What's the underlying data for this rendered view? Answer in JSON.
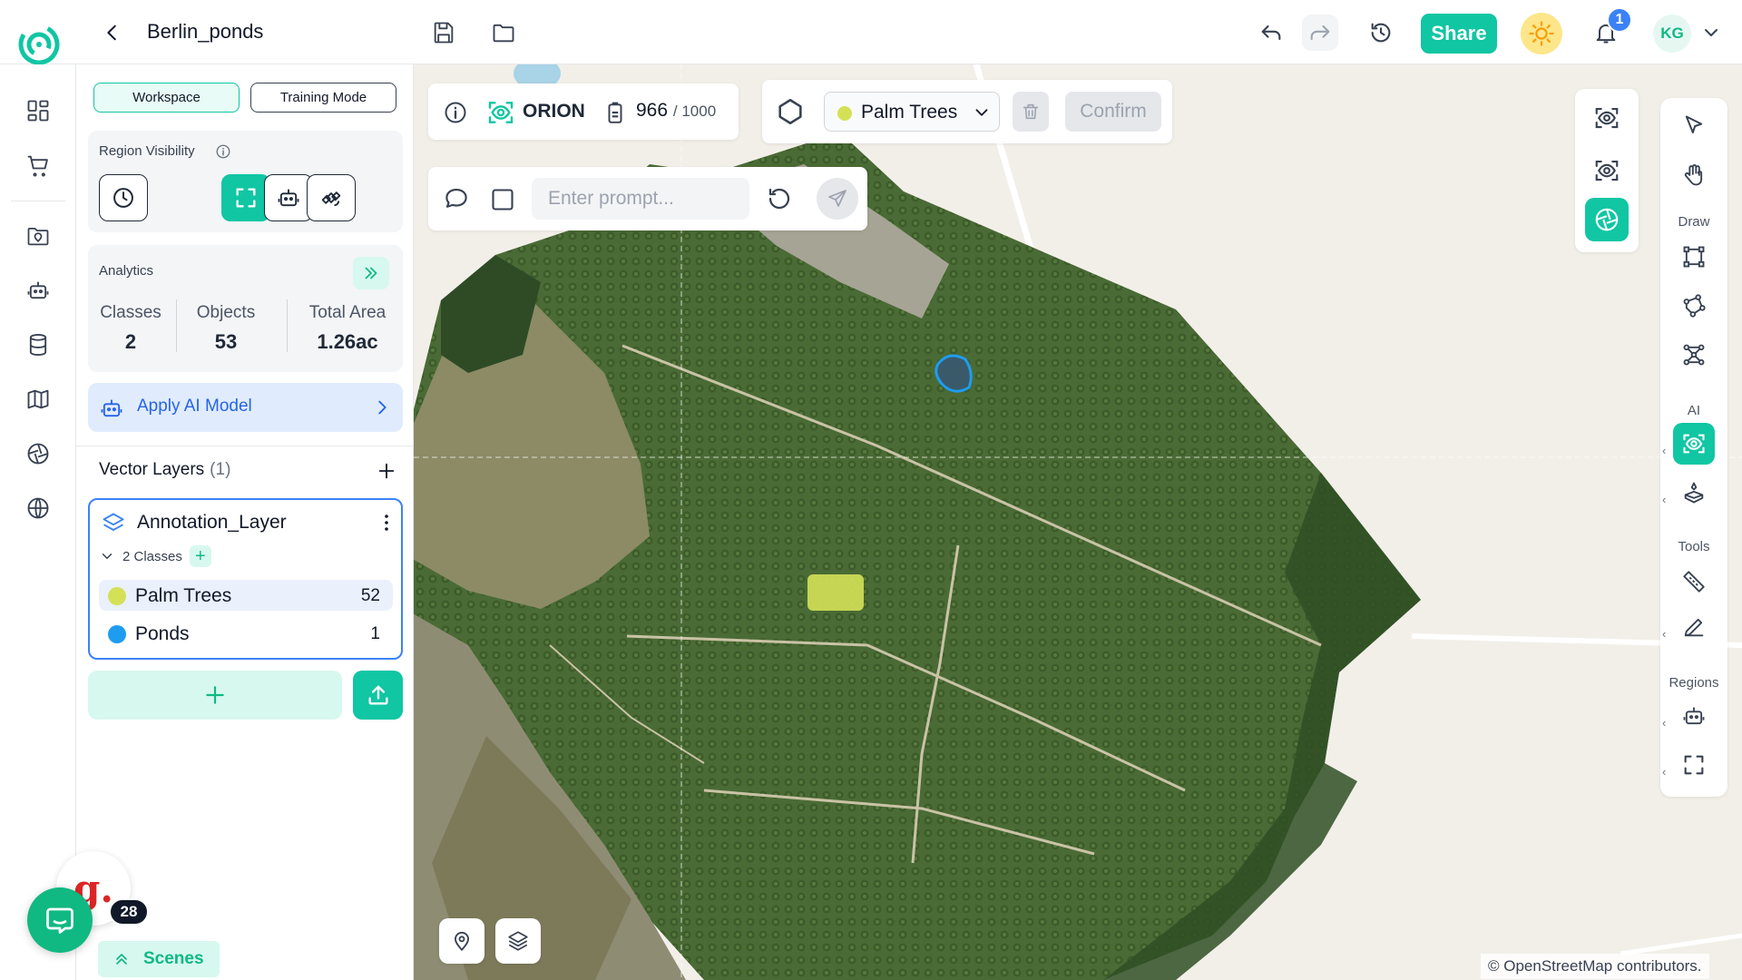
{
  "header": {
    "project_title": "Berlin_ponds",
    "share_label": "Share",
    "notification_count": "1",
    "avatar_initials": "KG"
  },
  "panel": {
    "modes": {
      "workspace": "Workspace",
      "training": "Training Mode"
    },
    "region_visibility_title": "Region Visibility",
    "analytics": {
      "title": "Analytics",
      "classes_label": "Classes",
      "classes_value": "2",
      "objects_label": "Objects",
      "objects_value": "53",
      "area_label": "Total Area",
      "area_value": "1.26ac"
    },
    "apply_ai_label": "Apply AI Model",
    "vector_layers": {
      "title": "Vector Layers",
      "count": "(1)"
    },
    "layer": {
      "name": "Annotation_Layer",
      "classes_summary": "2 Classes",
      "classes": [
        {
          "name": "Palm Trees",
          "count": "52",
          "color": "#d4e157"
        },
        {
          "name": "Ponds",
          "count": "1",
          "color": "#1e9cf0"
        }
      ]
    },
    "scenes_label": "Scenes"
  },
  "chat": {
    "badge_count": "28",
    "logo_letter": "g."
  },
  "map_overlay": {
    "model_name": "ORION",
    "credits_used": "966",
    "credits_total": "/ 1000",
    "selected_class": "Palm Trees",
    "confirm_label": "Confirm",
    "prompt_placeholder": "Enter prompt...",
    "attribution": "© OpenStreetMap contributors."
  },
  "right_toolbar": {
    "draw_label": "Draw",
    "ai_label": "AI",
    "tools_label": "Tools",
    "regions_label": "Regions"
  },
  "colors": {
    "accent": "#10c6a3",
    "palm_trees": "#d4e157",
    "ponds": "#1e9cf0",
    "ai_blue": "#2563eb"
  }
}
